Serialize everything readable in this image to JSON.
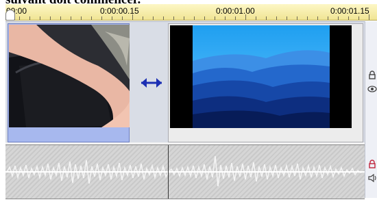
{
  "caption": {
    "text": "suivant doit commencer."
  },
  "ruler": {
    "labels": [
      "00:00",
      "0:00:00.15",
      "0:00:01.00",
      "0:00:01.15"
    ]
  },
  "timeline": {
    "clips": [
      {
        "kind": "video",
        "thumbnail": "bag-with-arm"
      },
      {
        "kind": "video",
        "thumbnail": "blue-mountains"
      }
    ],
    "audio": {
      "kind": "audio-waveform"
    }
  },
  "icons": {
    "resize_cursor": "double-arrow-horizontal",
    "video_lock": "lock-icon",
    "video_visibility": "eye-icon",
    "audio_lock": "lock-icon",
    "audio_speaker": "speaker-icon"
  },
  "colors": {
    "ruler_bg": "#f0e493",
    "selected_clip": "#a7b8ee",
    "cursor": "#1c2fb3",
    "audio_lock": "#c0243b"
  }
}
